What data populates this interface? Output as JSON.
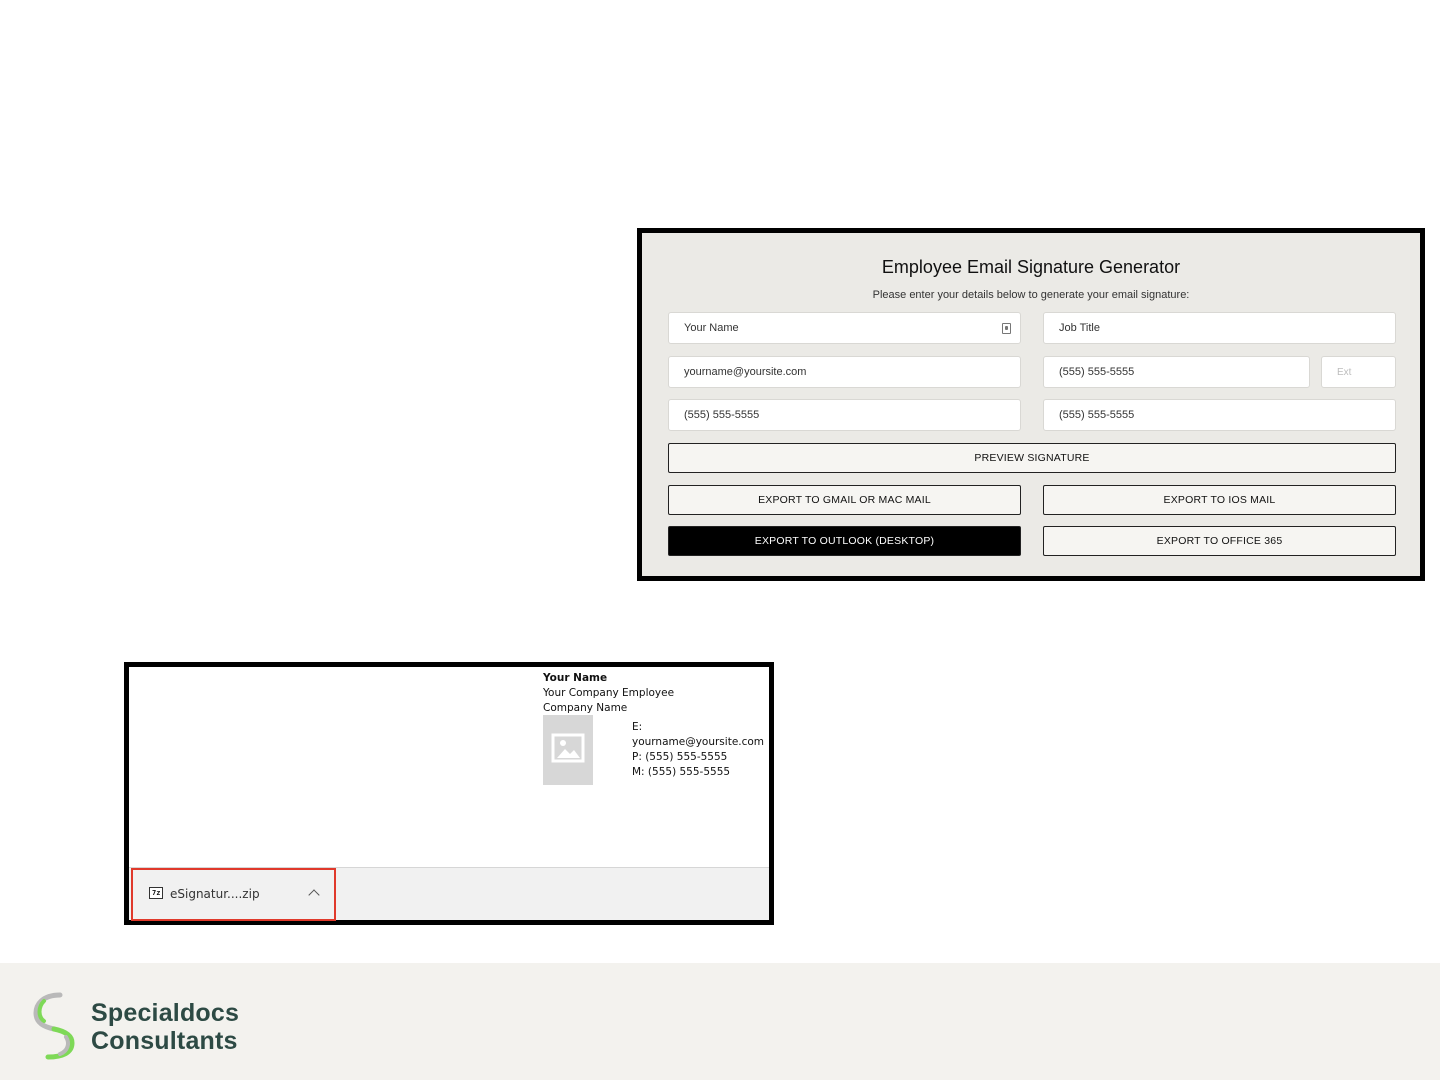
{
  "generator": {
    "title": "Employee Email Signature Generator",
    "subtitle": "Please enter your details below to generate your email signature:",
    "fields": {
      "name": "Your Name",
      "job_title": "Job Title",
      "email": "yourname@yoursite.com",
      "phone": "(555) 555-5555",
      "ext_placeholder": "Ext",
      "mobile": "(555) 555-5555",
      "fax": "(555) 555-5555"
    },
    "buttons": {
      "preview": "PREVIEW SIGNATURE",
      "gmail": "EXPORT TO GMAIL OR MAC MAIL",
      "ios": "EXPORT TO IOS MAIL",
      "outlook": "EXPORT TO OUTLOOK (DESKTOP)",
      "office365": "EXPORT TO OFFICE 365"
    }
  },
  "signature_preview": {
    "name": "Your Name",
    "role": "Your Company Employee",
    "company": "Company Name",
    "email_line": "E: yourname@yoursite.com",
    "phone_line": "P: (555) 555-5555",
    "mobile_line": "M: (555) 555-5555",
    "photo_icon": "image-placeholder-icon"
  },
  "download_bar": {
    "file_name": "eSignatur....zip",
    "file_icon": "7z-archive-icon",
    "icon_label": "7z",
    "expand_icon": "chevron-up-icon",
    "highlight_color": "#e0392b"
  },
  "footer": {
    "brand_line1": "Specialdocs",
    "brand_line2": "Consultants",
    "brand_color": "#2d4a44",
    "accent_color": "#7ed957"
  }
}
